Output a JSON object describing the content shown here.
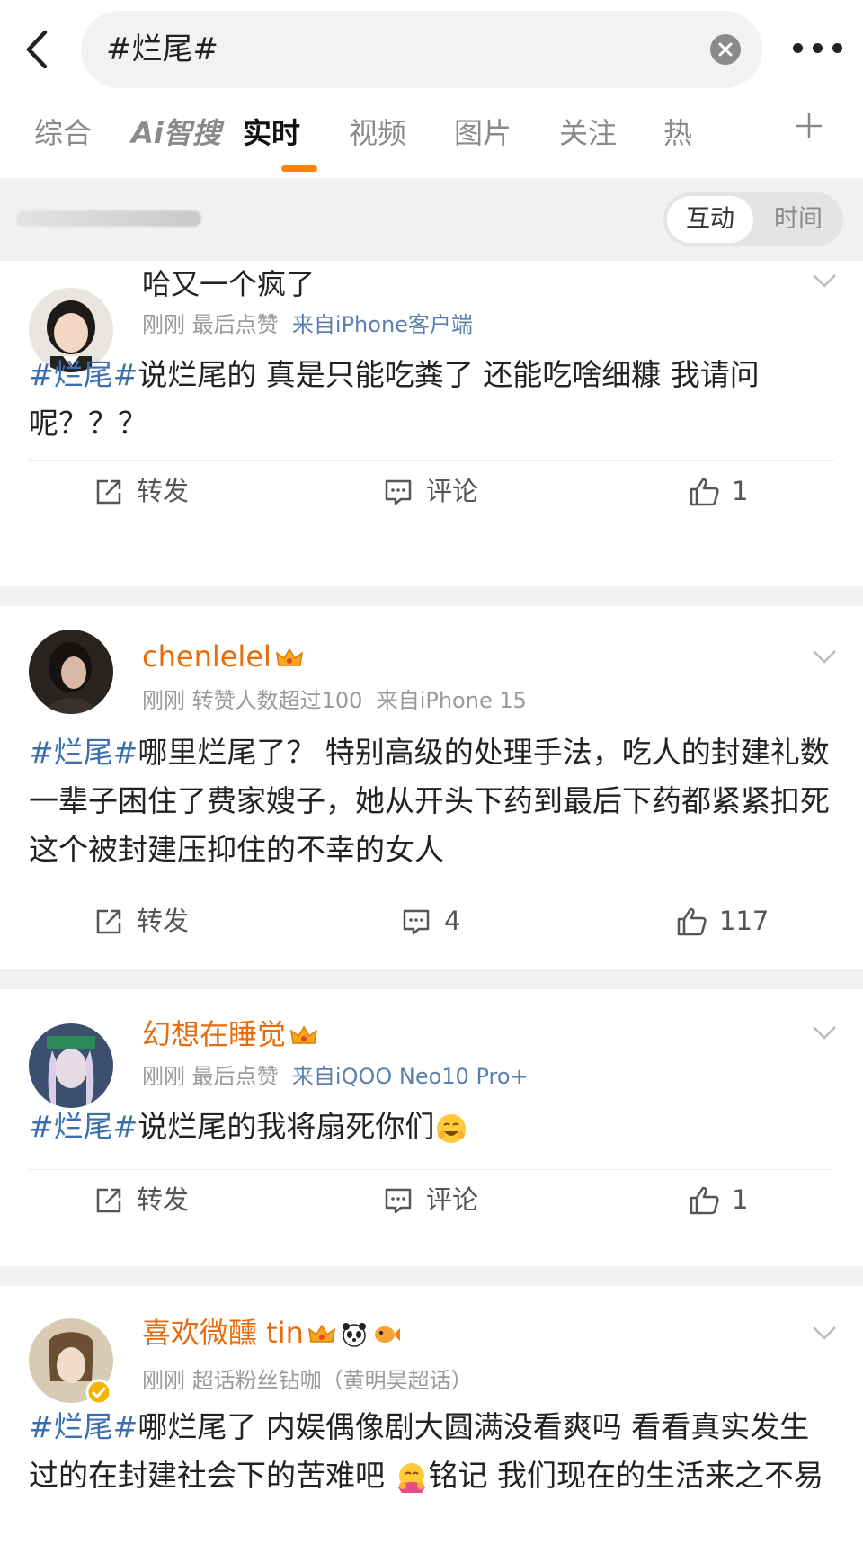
{
  "search": {
    "query": "#烂尾#"
  },
  "tabs": [
    {
      "label": "综合"
    },
    {
      "label": "Ai智搜"
    },
    {
      "label": "实时"
    },
    {
      "label": "视频"
    },
    {
      "label": "图片"
    },
    {
      "label": "关注"
    },
    {
      "label": "热"
    }
  ],
  "active_tab": "实时",
  "sort_toggle": {
    "left": "互动",
    "right": "时间",
    "selected": "互动"
  },
  "colors": {
    "accent": "#ff8200",
    "hashtag": "#3b6fb4",
    "vip_name": "#e86b0c"
  },
  "posts": [
    {
      "name": "哈又一个疯了",
      "meta": "刚刚  最后点赞",
      "source": "来自iPhone客户端",
      "hashtag": "#烂尾#",
      "text": "说烂尾的 真是只能吃粪了 还能吃啥细糠 我请问呢？？？",
      "repost": "转发",
      "comment": "评论",
      "likes": "1"
    },
    {
      "name": "chenlelel",
      "meta": "刚刚  转赞人数超过100",
      "source": "来自iPhone 15",
      "hashtag": "#烂尾#",
      "text": "哪里烂尾了？ 特别高级的处理手法，吃人的封建礼数一辈子困住了费家嫂子，她从开头下药到最后下药都紧紧扣死这个被封建压抑住的不幸的女人",
      "repost": "转发",
      "comment": "4",
      "likes": "117"
    },
    {
      "name": "幻想在睡觉",
      "meta": "刚刚  最后点赞",
      "source": "来自iQOO Neo10 Pro+",
      "hashtag": "#烂尾#",
      "text": "说烂尾的我将扇死你们",
      "repost": "转发",
      "comment": "评论",
      "likes": "1"
    },
    {
      "name": "喜欢微醺 tin",
      "meta": "刚刚  超话粉丝钻咖（黄明昊超话）",
      "hashtag": "#烂尾#",
      "text_a": "哪烂尾了 内娱偶像剧大圆满没看爽吗 看看真实发生过的在封建社会下的苦难吧",
      "text_b": "铭记 我们现在的生活来之不易"
    }
  ]
}
